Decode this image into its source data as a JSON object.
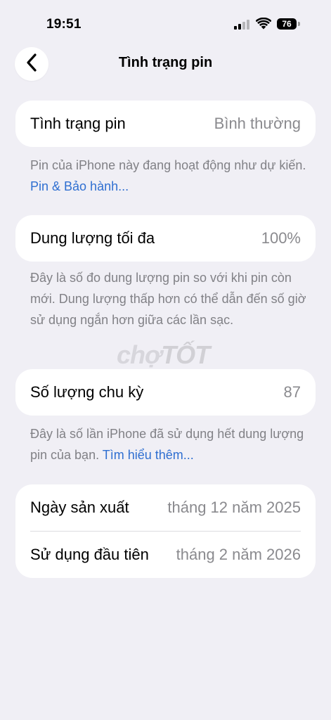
{
  "status_bar": {
    "time": "19:51",
    "battery_level": "76"
  },
  "nav": {
    "title": "Tình trạng pin"
  },
  "health_card": {
    "label": "Tình trạng pin",
    "value": "Bình thường"
  },
  "health_note": {
    "text": "Pin của iPhone này đang hoạt động như dự kiến. ",
    "link": "Pin & Bảo hành..."
  },
  "capacity_card": {
    "label": "Dung lượng tối đa",
    "value": "100%"
  },
  "capacity_note": {
    "text": "Đây là số đo dung lượng pin so với khi pin còn mới. Dung lượng thấp hơn có thể dẫn đến số giờ sử dụng ngắn hơn giữa các lần sạc."
  },
  "cycle_card": {
    "label": "Số lượng chu kỳ",
    "value": "87"
  },
  "cycle_note": {
    "text": "Đây là số lần iPhone đã sử dụng hết dung lượng pin của bạn. ",
    "link": "Tìm hiểu thêm..."
  },
  "dates_card": {
    "manufacture_label": "Ngày sản xuất",
    "manufacture_value": "tháng 12 năm 2025",
    "first_use_label": "Sử dụng đầu tiên",
    "first_use_value": "tháng 2 năm 2026"
  },
  "watermark": {
    "prefix": "chợ",
    "suffix": "TỐT"
  },
  "colors": {
    "background": "#f0eff5",
    "card": "#ffffff",
    "secondary_text": "#8a8a8e",
    "link": "#2f6fd1"
  }
}
